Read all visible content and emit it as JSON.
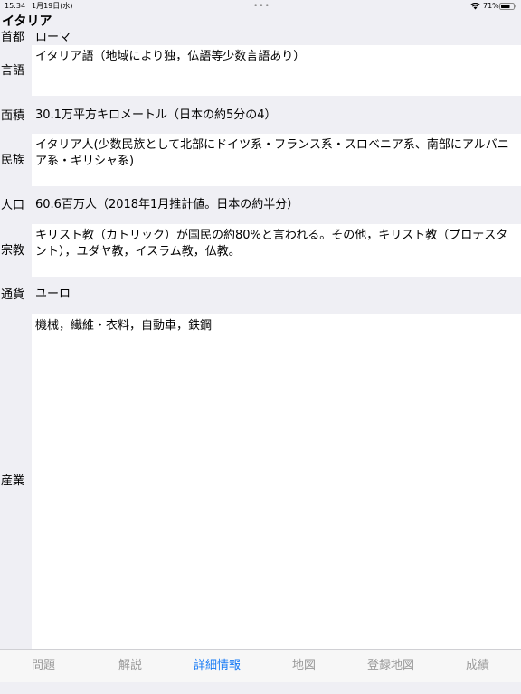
{
  "status_bar": {
    "time": "15:34",
    "date": "1月19日(水)",
    "dots": "•••",
    "battery": "71%"
  },
  "title": "イタリア",
  "rows": [
    {
      "label": "首都",
      "value": "ローマ"
    },
    {
      "label": "言語",
      "value": "イタリア語（地域により独，仏語等少数言語あり）"
    },
    {
      "label": "面積",
      "value": "30.1万平方キロメートル（日本の約5分の4）"
    },
    {
      "label": "民族",
      "value": "イタリア人(少数民族として北部にドイツ系・フランス系・スロベニア系、南部にアルバニア系・ギリシャ系)"
    },
    {
      "label": "人口",
      "value": "60.6百万人（2018年1月推計値。日本の約半分）"
    },
    {
      "label": "宗教",
      "value": "キリスト教（カトリック）が国民の約80%と言われる。その他，キリスト教（プロテスタント），ユダヤ教，イスラム教，仏教。"
    },
    {
      "label": "通貨",
      "value": "ユーロ"
    },
    {
      "label": "産業",
      "value": "機械，繊維・衣料，自動車，鉄鋼"
    }
  ],
  "tabs": [
    {
      "label": "問題",
      "active": false
    },
    {
      "label": "解説",
      "active": false
    },
    {
      "label": "詳細情報",
      "active": true
    },
    {
      "label": "地図",
      "active": false
    },
    {
      "label": "登録地図",
      "active": false
    },
    {
      "label": "成績",
      "active": false
    }
  ],
  "colors": {
    "accent": "#1a7cf5",
    "tab_inactive": "#9a9a9a",
    "background": "#efeff4",
    "field": "#ffffff"
  }
}
